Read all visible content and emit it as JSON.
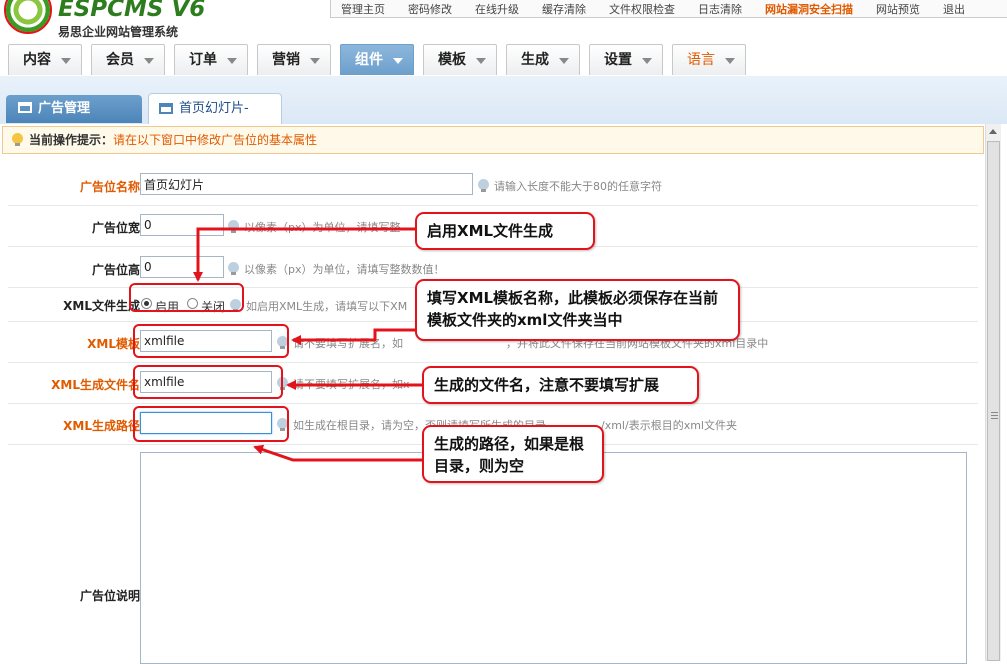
{
  "header": {
    "logo_brand": "ESPCMS V6",
    "logo_subtitle": "易思企业网站管理系统",
    "top_links": [
      {
        "label": "管理主页",
        "hot": false
      },
      {
        "label": "密码修改",
        "hot": false
      },
      {
        "label": "在线升级",
        "hot": false
      },
      {
        "label": "缓存清除",
        "hot": false
      },
      {
        "label": "文件权限检查",
        "hot": false
      },
      {
        "label": "日志清除",
        "hot": false
      },
      {
        "label": "网站漏洞安全扫描",
        "hot": true
      },
      {
        "label": "网站预览",
        "hot": false
      },
      {
        "label": "退出",
        "hot": false
      }
    ]
  },
  "nav": {
    "tabs": [
      {
        "label": "内容"
      },
      {
        "label": "会员"
      },
      {
        "label": "订单"
      },
      {
        "label": "营销"
      },
      {
        "label": "组件"
      },
      {
        "label": "模板"
      },
      {
        "label": "生成"
      },
      {
        "label": "设置"
      },
      {
        "label": "语言"
      }
    ],
    "active_tab": "组件"
  },
  "subtabs": {
    "ad_manage": "广告管理",
    "slideshow": "首页幻灯片-"
  },
  "hint": {
    "label": "当前操作提示：",
    "text": "请在以下窗口中修改广告位的基本属性"
  },
  "form": {
    "name": {
      "label": "广告位名称",
      "value": "首页幻灯片",
      "tip": "请输入长度不能大于80的任意字符"
    },
    "width": {
      "label": "广告位宽",
      "value": "0",
      "tip": "以像素（px）为单位，请填写整"
    },
    "height": {
      "label": "广告位高",
      "value": "0",
      "tip": "以像素（px）为单位，请填写整数数值！"
    },
    "xml_gen": {
      "label": "XML文件生成",
      "opt_on": "启用",
      "opt_off": "关闭",
      "selected": "启用",
      "tip": "如启用XML生成，请填写以下XM"
    },
    "xml_tpl": {
      "label": "XML模板",
      "value": "xmlfile",
      "tip_a": "请不要填写扩展名，如",
      "tip_b": "，并将此文件保存在当前网站模板文件夹的xml目录中"
    },
    "xml_file": {
      "label": "XML生成文件名",
      "value": "xmlfile",
      "tip": "请不要填写扩展名，如x"
    },
    "xml_path": {
      "label": "XML生成路径",
      "value": "",
      "tip_a": "如生成在根目录，请为空，否则请填写所生成的目录，",
      "tip_b": "/xml/表示根目的xml文件夹"
    },
    "desc": {
      "label": "广告位说明"
    }
  },
  "callouts": {
    "enable_xml": "启用XML文件生成",
    "xml_tpl": "填写XML模板名称，此模板必须保存在当前模板文件夹的xml文件夹当中",
    "file_name": "生成的文件名，注意不要填写扩展",
    "gen_path": "生成的路径，如果是根目录，则为空"
  },
  "colors": {
    "accent_orange": "#e05a00",
    "annotation_red": "#e3131b",
    "active_tab_blue": "#6c9fcc",
    "logo_green": "#2d7d1e"
  }
}
